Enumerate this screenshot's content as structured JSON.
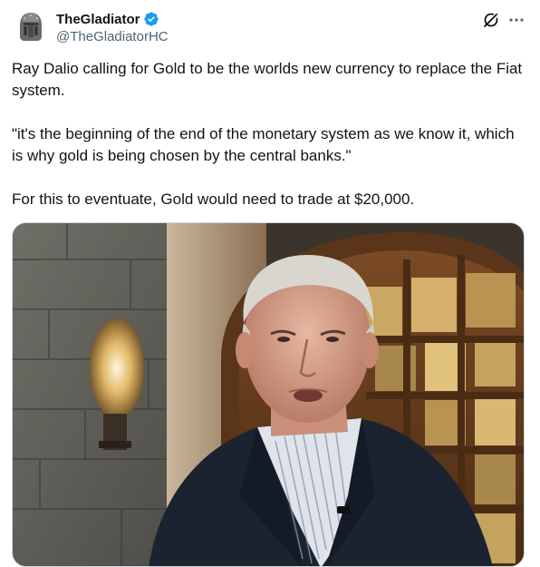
{
  "author": {
    "display_name": "TheGladiator",
    "handle": "@TheGladiatorHC",
    "verified": true,
    "verified_color": "#1d9bf0"
  },
  "tweet": {
    "paragraphs": [
      "Ray Dalio calling for Gold to be the worlds new currency to replace the Fiat system.",
      "\"it's the beginning of the end of the monetary system as we know it, which is why gold is being chosen by the central banks.\"",
      "For this to eventuate, Gold would need to trade at $20,000."
    ]
  },
  "icons": {
    "avatar": "gladiator-helmet-avatar",
    "verified": "verified-badge-icon",
    "grok": "grok-icon",
    "more": "more-options-icon"
  },
  "media": {
    "type": "video-still"
  }
}
